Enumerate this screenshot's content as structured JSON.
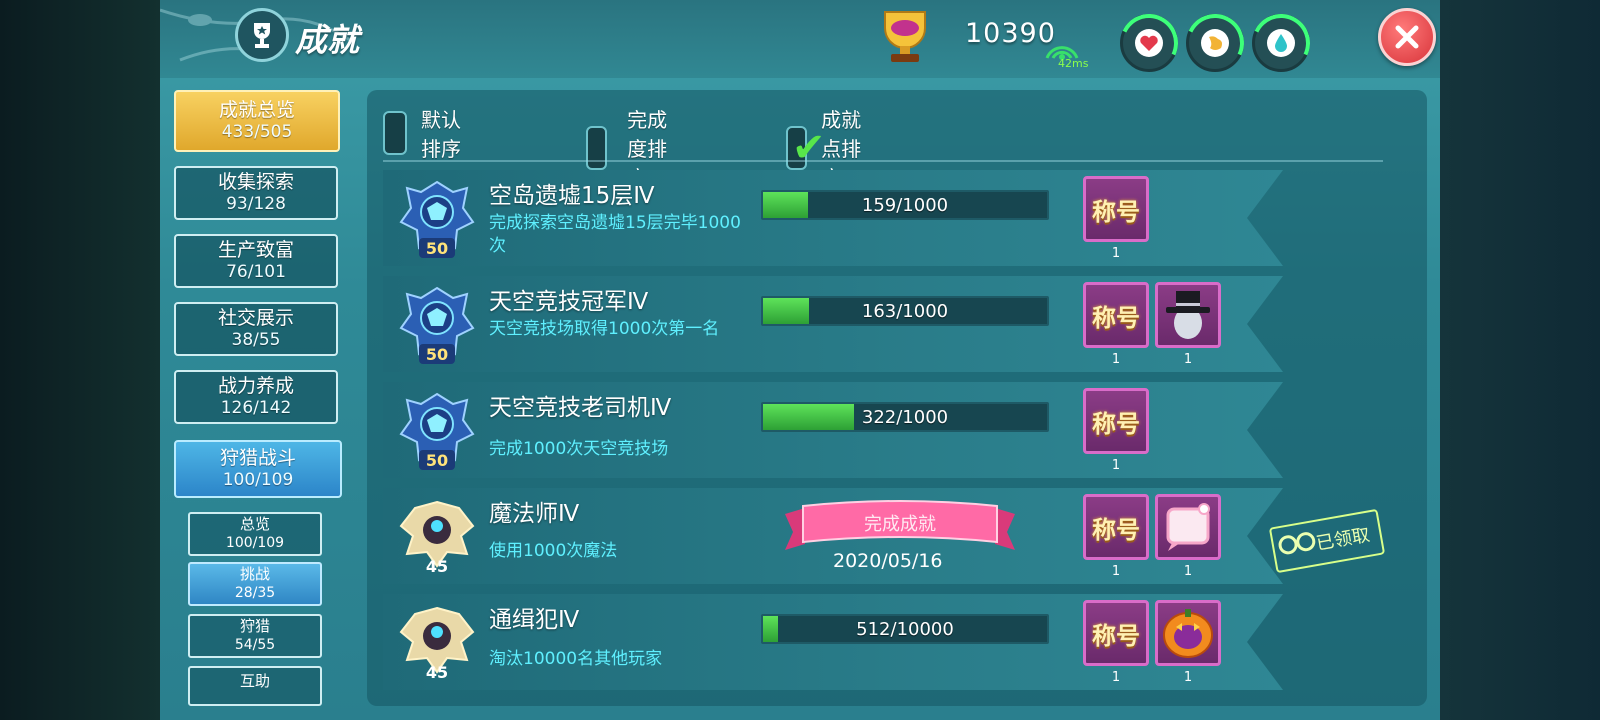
{
  "header": {
    "title": "成就",
    "points": "10390",
    "ping": "42ms",
    "stats": [
      {
        "icon": "heart-icon",
        "color": "#e3394b"
      },
      {
        "icon": "stomach-icon",
        "color": "#f2b335"
      },
      {
        "icon": "water-drop-icon",
        "color": "#2ec3c9"
      }
    ],
    "accent_color": "#3d9da8"
  },
  "sidebar": {
    "categories": [
      {
        "label": "成就总览",
        "count": "433/505"
      },
      {
        "label": "收集探索",
        "count": "93/128"
      },
      {
        "label": "生产致富",
        "count": "76/101"
      },
      {
        "label": "社交展示",
        "count": "38/55"
      },
      {
        "label": "战力养成",
        "count": "126/142"
      },
      {
        "label": "狩猎战斗",
        "count": "100/109"
      }
    ],
    "subcategories": [
      {
        "label": "总览",
        "count": "100/109"
      },
      {
        "label": "挑战",
        "count": "28/35"
      },
      {
        "label": "狩猎",
        "count": "54/55"
      },
      {
        "label": "互助",
        "count": ""
      }
    ]
  },
  "sort": {
    "options": [
      {
        "label": "默认排序",
        "checked": false
      },
      {
        "label": "完成度排序",
        "checked": false
      },
      {
        "label": "成就点排序",
        "checked": true
      }
    ]
  },
  "achievements": [
    {
      "title": "空岛遗墟15层Ⅳ",
      "desc": "完成探索空岛遗墟15层完毕1000次",
      "badge_level": "50",
      "progress_text": "159/1000",
      "progress": 0.159,
      "rewards": [
        {
          "label": "称号",
          "count": "1",
          "type": "title"
        }
      ]
    },
    {
      "title": "天空竞技冠军Ⅳ",
      "desc": "天空竞技场取得1000次第一名",
      "badge_level": "50",
      "progress_text": "163/1000",
      "progress": 0.163,
      "rewards": [
        {
          "label": "称号",
          "count": "1",
          "type": "title"
        },
        {
          "label": "",
          "count": "1",
          "type": "hat-avatar"
        }
      ]
    },
    {
      "title": "天空竞技老司机Ⅳ",
      "desc": "完成1000次天空竞技场",
      "badge_level": "50",
      "progress_text": "322/1000",
      "progress": 0.322,
      "rewards": [
        {
          "label": "称号",
          "count": "1",
          "type": "title"
        }
      ]
    },
    {
      "title": "魔法师Ⅳ",
      "desc": "使用1000次魔法",
      "badge_level": "45",
      "completed": true,
      "complete_text": "完成成就",
      "complete_date": "2020/05/16",
      "rewards": [
        {
          "label": "称号",
          "count": "1",
          "type": "title"
        },
        {
          "label": "",
          "count": "1",
          "type": "chat-frame"
        }
      ]
    },
    {
      "title": "通缉犯Ⅳ",
      "desc": "淘汰10000名其他玩家",
      "badge_level": "45",
      "progress_text": "512/10000",
      "progress": 0.0512,
      "rewards": [
        {
          "label": "称号",
          "count": "1",
          "type": "title"
        },
        {
          "label": "",
          "count": "1",
          "type": "pumpkin-frame"
        }
      ]
    }
  ],
  "claimed_label": "已领取"
}
